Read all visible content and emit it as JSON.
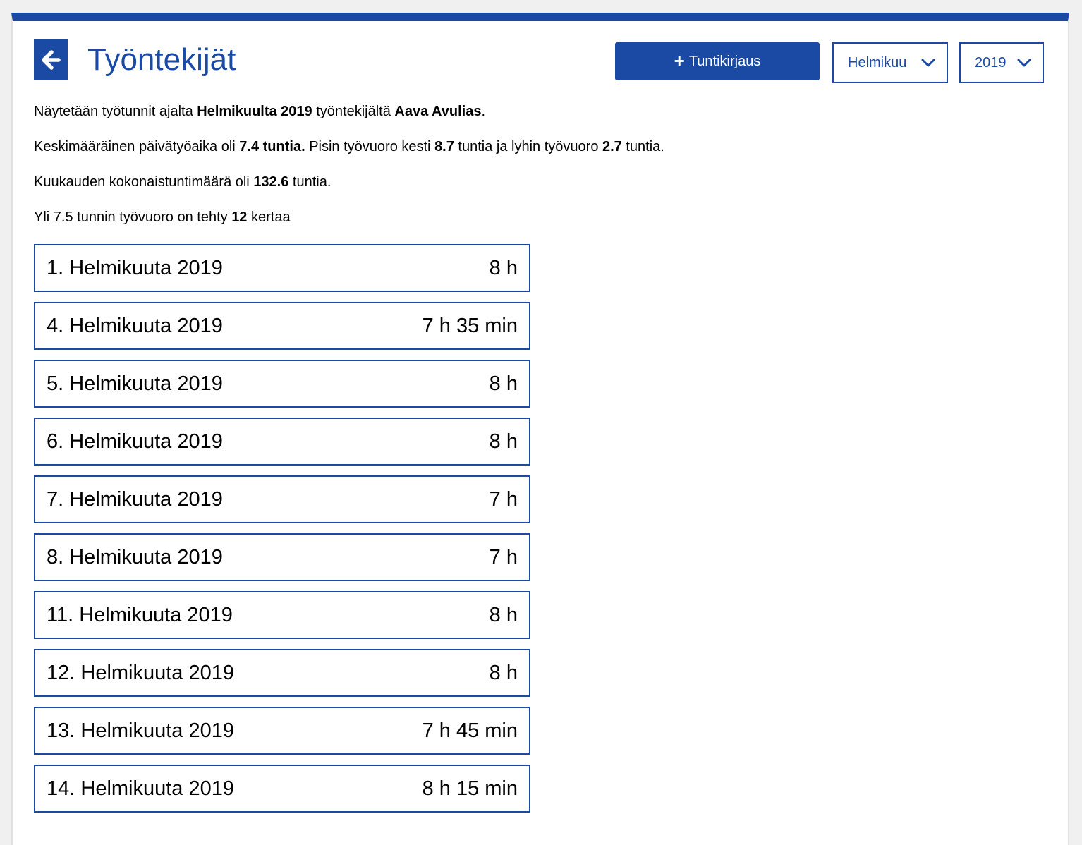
{
  "header": {
    "title": "Työntekijät",
    "add_button_label": "Tuntikirjaus",
    "month_select": "Helmikuu",
    "year_select": "2019"
  },
  "summary": {
    "line1": {
      "prefix": "Näytetään työtunnit ajalta ",
      "period": "Helmikuulta 2019",
      "middle": " työntekijältä ",
      "employee": "Aava Avulias",
      "suffix": "."
    },
    "line2": {
      "t1": "Keskimääräinen päivätyöaika oli ",
      "avg": "7.4 tuntia.",
      "t2": " Pisin työvuoro kesti ",
      "max": "8.7",
      "t3": " tuntia ja lyhin työvuoro ",
      "min": "2.7",
      "t4": " tuntia."
    },
    "line3": {
      "t1": "Kuukauden kokonaistuntimäärä oli ",
      "total": "132.6",
      "t2": " tuntia."
    },
    "line4": {
      "t1": "Yli 7.5 tunnin työvuoro on tehty ",
      "count": "12",
      "t2": " kertaa"
    }
  },
  "days": [
    {
      "date": "1. Helmikuuta 2019",
      "hours": "8 h"
    },
    {
      "date": "4. Helmikuuta 2019",
      "hours": "7 h 35 min"
    },
    {
      "date": "5. Helmikuuta 2019",
      "hours": "8 h"
    },
    {
      "date": "6. Helmikuuta 2019",
      "hours": "8 h"
    },
    {
      "date": "7. Helmikuuta 2019",
      "hours": "7 h"
    },
    {
      "date": "8. Helmikuuta 2019",
      "hours": "7 h"
    },
    {
      "date": "11. Helmikuuta 2019",
      "hours": "8 h"
    },
    {
      "date": "12. Helmikuuta 2019",
      "hours": "8 h"
    },
    {
      "date": "13. Helmikuuta 2019",
      "hours": "7 h 45 min"
    },
    {
      "date": "14. Helmikuuta 2019",
      "hours": "8 h 15 min"
    }
  ],
  "icons": {
    "back": "arrow-left-icon",
    "add": "plus-icon",
    "dropdown": "chevron-down-icon"
  },
  "colors": {
    "brand": "#1a4aa3"
  }
}
